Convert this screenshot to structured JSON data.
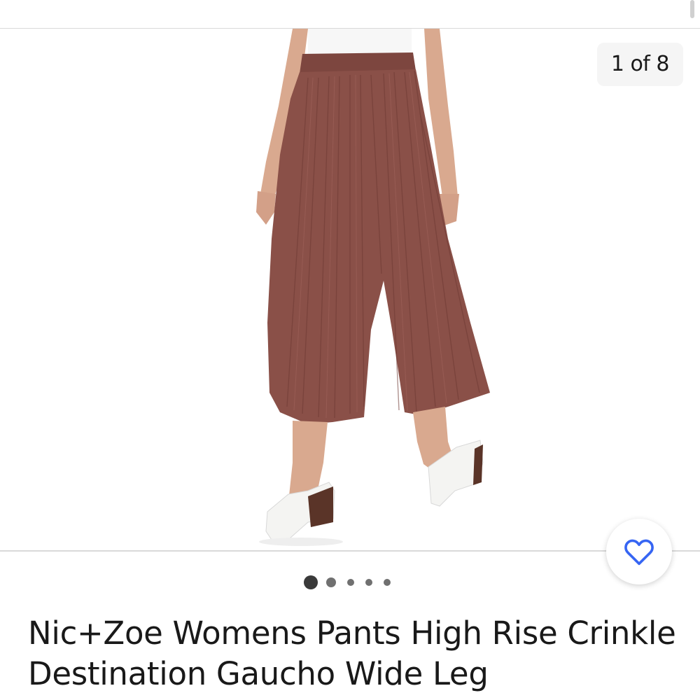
{
  "gallery": {
    "counter_text": "1 of 8",
    "image_subject": "model wearing brown crinkle wide leg gaucho pants with white heeled mules",
    "pagination": {
      "total_dots": 5,
      "active_index": 0
    }
  },
  "favorite": {
    "icon": "heart-outline-icon",
    "color": "#3665f3"
  },
  "listing": {
    "title": "Nic+Zoe Womens Pants High Rise Crinkle Destination Gaucho Wide Leg"
  },
  "colors": {
    "pants": "#8a5048",
    "accent": "#3665f3"
  }
}
